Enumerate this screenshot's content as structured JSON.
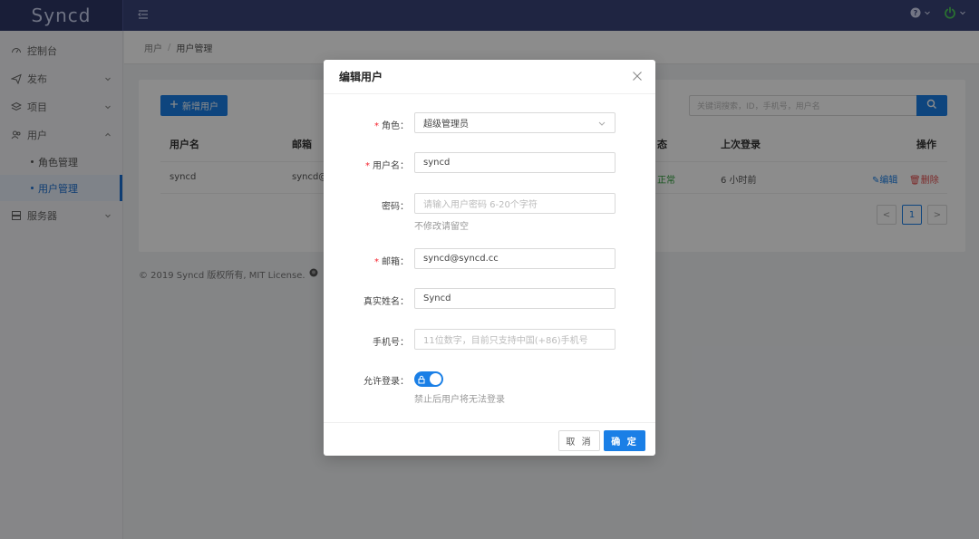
{
  "app": {
    "logo": "Syncd"
  },
  "topbar": {
    "menu_toggle_icon": "menu-fold-icon",
    "help_icon": "question-circle-icon",
    "power_icon": "power-icon",
    "accent": "#3a4478"
  },
  "sidebar": {
    "items": [
      {
        "label": "控制台",
        "icon": "dashboard-icon"
      },
      {
        "label": "发布",
        "icon": "send-icon",
        "arrow": "⌄"
      },
      {
        "label": "项目",
        "icon": "layers-icon",
        "arrow": "⌄"
      },
      {
        "label": "用户",
        "icon": "user-icon",
        "arrow": "⌃"
      },
      {
        "label": "服务器",
        "icon": "server-icon",
        "arrow": "⌄"
      }
    ],
    "sub_items": [
      {
        "label": "角色管理"
      },
      {
        "label": "用户管理",
        "active": true
      }
    ]
  },
  "breadcrumb": {
    "root": "用户",
    "sep": "/",
    "current": "用户管理"
  },
  "toolbar": {
    "add_label": "新增用户",
    "add_icon": "plus-icon",
    "search_placeholder": "关键词搜索，ID，手机号，用户名"
  },
  "table": {
    "columns": [
      "用户名",
      "邮箱",
      "态",
      "上次登录",
      "操作"
    ],
    "rows": [
      {
        "username": "syncd",
        "email": "syncd@",
        "status": "正常",
        "last_login": "6 小时前",
        "edit": "编辑",
        "delete": "删除"
      }
    ]
  },
  "pagination": {
    "prev": "<",
    "current": "1",
    "next": ">"
  },
  "footer": {
    "text": "© 2019 Syncd 版权所有, MIT License."
  },
  "modal": {
    "title": "编辑用户",
    "role": {
      "label": "角色",
      "value": "超级管理员",
      "required": true
    },
    "username": {
      "label": "用户名",
      "value": "syncd",
      "required": true
    },
    "password": {
      "label": "密码",
      "placeholder": "请输入用户密码 6-20个字符",
      "help": "不修改请留空"
    },
    "email": {
      "label": "邮箱",
      "value": "syncd@syncd.cc",
      "required": true
    },
    "truename": {
      "label": "真实姓名",
      "value": "Syncd"
    },
    "mobile": {
      "label": "手机号",
      "placeholder": "11位数字，目前只支持中国(+86)手机号"
    },
    "allow_login": {
      "label": "允许登录",
      "enabled": true,
      "help": "禁止后用户将无法登录"
    },
    "cancel_label": "取 消",
    "ok_label": "确 定",
    "colon": "："
  }
}
